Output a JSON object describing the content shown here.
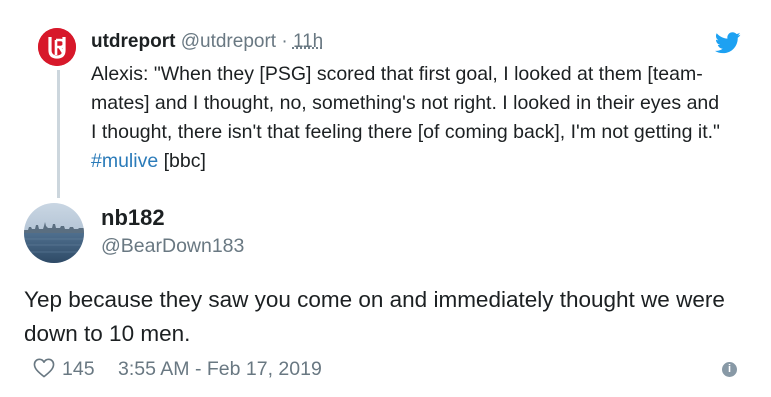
{
  "parent_tweet": {
    "author_name": "utdreport",
    "author_handle": "@utdreport",
    "separator": "·",
    "time": "11h",
    "text_main": "Alexis: \"When they [PSG] scored that first goal, I looked at them [team-mates] and I thought, no, something's not right. I looked in their eyes and I thought, there isn't that feeling there [of coming back], I'm not getting it.\"",
    "hashtag": "#mulive",
    "text_tail": "[bbc]",
    "logo_color": "#d7182a"
  },
  "tweet": {
    "author_name": "nb182",
    "author_handle": "@BearDown183",
    "text": "Yep because they saw you come on and immediately thought we were down to 10 men.",
    "like_count": "145",
    "timestamp": "3:55 AM - Feb 17, 2019"
  },
  "icons": {
    "twitter": "twitter-bird-icon",
    "like": "heart-icon",
    "info": "info-icon"
  },
  "colors": {
    "text": "#1c2022",
    "muted": "#697882",
    "link": "#2b7bb9",
    "twitter_blue": "#1da1f2"
  }
}
